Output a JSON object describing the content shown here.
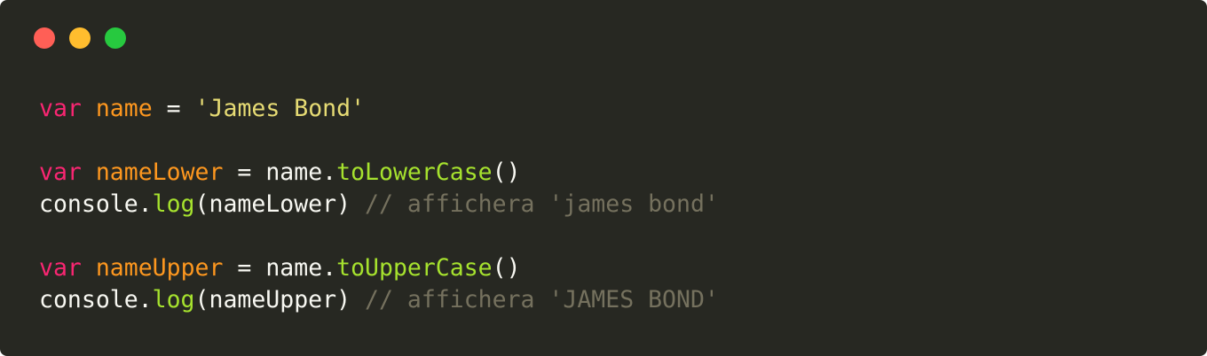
{
  "window": {
    "background": "#272822",
    "controls": [
      {
        "name": "close",
        "color": "#ff5f56"
      },
      {
        "name": "minimize",
        "color": "#ffbd2e"
      },
      {
        "name": "maximize",
        "color": "#27c93f"
      }
    ]
  },
  "code": {
    "language": "javascript",
    "theme": "monokai",
    "lines": [
      [
        {
          "type": "keyword",
          "text": "var"
        },
        {
          "type": "plain",
          "text": " "
        },
        {
          "type": "variable",
          "text": "name"
        },
        {
          "type": "plain",
          "text": " "
        },
        {
          "type": "operator",
          "text": "="
        },
        {
          "type": "plain",
          "text": " "
        },
        {
          "type": "string",
          "text": "'James Bond'"
        }
      ],
      [],
      [
        {
          "type": "keyword",
          "text": "var"
        },
        {
          "type": "plain",
          "text": " "
        },
        {
          "type": "variable",
          "text": "nameLower"
        },
        {
          "type": "plain",
          "text": " "
        },
        {
          "type": "operator",
          "text": "="
        },
        {
          "type": "plain",
          "text": " "
        },
        {
          "type": "plain",
          "text": "name."
        },
        {
          "type": "function",
          "text": "toLowerCase"
        },
        {
          "type": "punct",
          "text": "()"
        }
      ],
      [
        {
          "type": "plain",
          "text": "console."
        },
        {
          "type": "function",
          "text": "log"
        },
        {
          "type": "punct",
          "text": "("
        },
        {
          "type": "plain",
          "text": "nameLower"
        },
        {
          "type": "punct",
          "text": ")"
        },
        {
          "type": "plain",
          "text": " "
        },
        {
          "type": "comment",
          "text": "// affichera 'james bond'"
        }
      ],
      [],
      [
        {
          "type": "keyword",
          "text": "var"
        },
        {
          "type": "plain",
          "text": " "
        },
        {
          "type": "variable",
          "text": "nameUpper"
        },
        {
          "type": "plain",
          "text": " "
        },
        {
          "type": "operator",
          "text": "="
        },
        {
          "type": "plain",
          "text": " "
        },
        {
          "type": "plain",
          "text": "name."
        },
        {
          "type": "function",
          "text": "toUpperCase"
        },
        {
          "type": "punct",
          "text": "()"
        }
      ],
      [
        {
          "type": "plain",
          "text": "console."
        },
        {
          "type": "function",
          "text": "log"
        },
        {
          "type": "punct",
          "text": "("
        },
        {
          "type": "plain",
          "text": "nameUpper"
        },
        {
          "type": "punct",
          "text": ")"
        },
        {
          "type": "plain",
          "text": " "
        },
        {
          "type": "comment",
          "text": "// affichera 'JAMES BOND'"
        }
      ]
    ]
  }
}
